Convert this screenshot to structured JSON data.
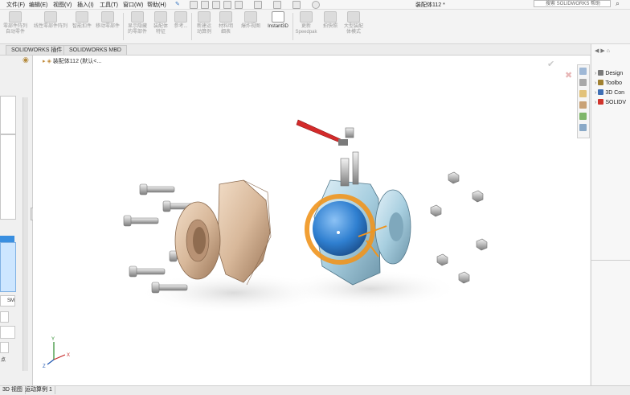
{
  "menu": {
    "items": [
      "文件(F)",
      "编辑(E)",
      "视图(V)",
      "插入(I)",
      "工具(T)",
      "窗口(W)",
      "帮助(H)"
    ],
    "title": "装配体112 *",
    "search_placeholder": "搜索 SOLIDWORKS 帮助"
  },
  "ribbon": {
    "commands": [
      {
        "label": "零部件阵列\n自动零件",
        "active": false
      },
      {
        "label": "线性零部件阵列",
        "active": false
      },
      {
        "label": "智能扣件",
        "active": false
      },
      {
        "label": "移动零部件",
        "active": false
      },
      {
        "label": "显示隐藏\n的零部件",
        "active": false
      },
      {
        "label": "装配体\n特征",
        "active": false
      },
      {
        "label": "参考...",
        "active": false
      },
      {
        "label": "新建运\n动算例",
        "active": false
      },
      {
        "label": "材料明\n细表",
        "active": false
      },
      {
        "label": "爆炸视图",
        "active": false
      },
      {
        "label": "Instant3D",
        "active": true
      },
      {
        "label": "更新\nSpeedpak",
        "active": false
      },
      {
        "label": "拍快照",
        "active": false
      },
      {
        "label": "大型装配\n体模式",
        "active": false
      }
    ]
  },
  "tabs": [
    "SOLIDWORKS 插件",
    "SOLIDWORKS MBD"
  ],
  "viewport": {
    "doc_node": "装配体112 (默认<...",
    "axis_labels": {
      "x": "X",
      "y": "Y",
      "z": "Z"
    }
  },
  "left_panel": {
    "label_sm": "SM",
    "label_pt": "点"
  },
  "right_panel": {
    "items": [
      {
        "label": "Design",
        "icon": "design-library-icon",
        "color": "#7a7a7a"
      },
      {
        "label": "Toolbo",
        "icon": "toolbox-icon",
        "color": "#a08030"
      },
      {
        "label": "3D Con",
        "icon": "3d-content-icon",
        "color": "#3f6fb5"
      },
      {
        "label": "SOLIDV",
        "icon": "solidworks-icon",
        "color": "#d0342c"
      }
    ]
  },
  "bottom": {
    "tabs": [
      "3D 视图",
      "运动算例 1"
    ]
  },
  "colors": {
    "accent": "#f0951e",
    "valve_body": "#a8cfe0",
    "ball": "#2f7fd0",
    "flange": "#d8b89a",
    "handle": "#d42a2a"
  }
}
